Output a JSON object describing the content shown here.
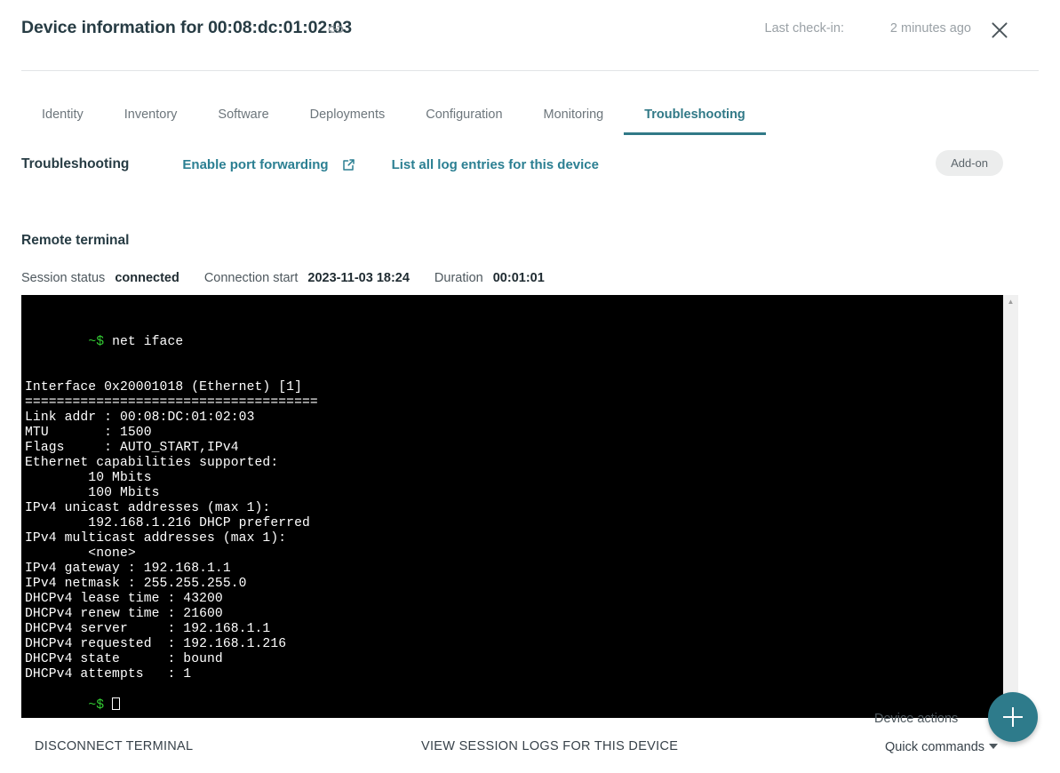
{
  "header": {
    "title": "Device information for 00:08:dc:01:02:03",
    "link_icon": "link-icon",
    "checkin_label": "Last check-in:",
    "checkin_value": "2 minutes ago",
    "close_icon": "close-icon"
  },
  "tabs": [
    {
      "label": "Identity",
      "active": false
    },
    {
      "label": "Inventory",
      "active": false
    },
    {
      "label": "Software",
      "active": false
    },
    {
      "label": "Deployments",
      "active": false
    },
    {
      "label": "Configuration",
      "active": false
    },
    {
      "label": "Monitoring",
      "active": false
    },
    {
      "label": "Troubleshooting",
      "active": true
    }
  ],
  "actions": {
    "section_title": "Troubleshooting",
    "port_forwarding_label": "Enable port forwarding",
    "external_link_icon": "external-link-icon",
    "log_entries_label": "List all log entries for this device",
    "addon_badge": "Add-on"
  },
  "terminal_section": {
    "title": "Remote terminal",
    "session_status_label": "Session status",
    "session_status_value": "connected",
    "connection_start_label": "Connection start",
    "connection_start_value": "2023-11-03 18:24",
    "duration_label": "Duration",
    "duration_value": "00:01:01"
  },
  "terminal": {
    "prompt": "~$",
    "command": "net iface",
    "lines": [
      "",
      "Interface 0x20001018 (Ethernet) [1]",
      "=====================================",
      "Link addr : 00:08:DC:01:02:03",
      "MTU       : 1500",
      "Flags     : AUTO_START,IPv4",
      "Ethernet capabilities supported:",
      "        10 Mbits",
      "        100 Mbits",
      "IPv4 unicast addresses (max 1):",
      "        192.168.1.216 DHCP preferred",
      "IPv4 multicast addresses (max 1):",
      "        <none>",
      "IPv4 gateway : 192.168.1.1",
      "IPv4 netmask : 255.255.255.0",
      "DHCPv4 lease time : 43200",
      "DHCPv4 renew time : 21600",
      "DHCPv4 server     : 192.168.1.1",
      "DHCPv4 requested  : 192.168.1.216",
      "DHCPv4 state      : bound",
      "DHCPv4 attempts   : 1"
    ],
    "final_prompt": "~$",
    "scrollbar_up_icon": "chevron-up-icon",
    "scrollbar_down_icon": "chevron-down-icon"
  },
  "footer": {
    "disconnect_label": "DISCONNECT TERMINAL",
    "view_logs_label": "VIEW SESSION LOGS FOR THIS DEVICE",
    "device_actions_label": "Device actions",
    "quick_commands_label": "Quick commands",
    "quick_commands_caret": "caret-down-icon",
    "fab_icon": "plus-icon"
  },
  "colors": {
    "accent_teal": "#317987",
    "link_teal": "#2b7f92",
    "fab_teal": "#2e7b8b",
    "terminal_bg": "#000000",
    "prompt_green": "#33cc33"
  }
}
